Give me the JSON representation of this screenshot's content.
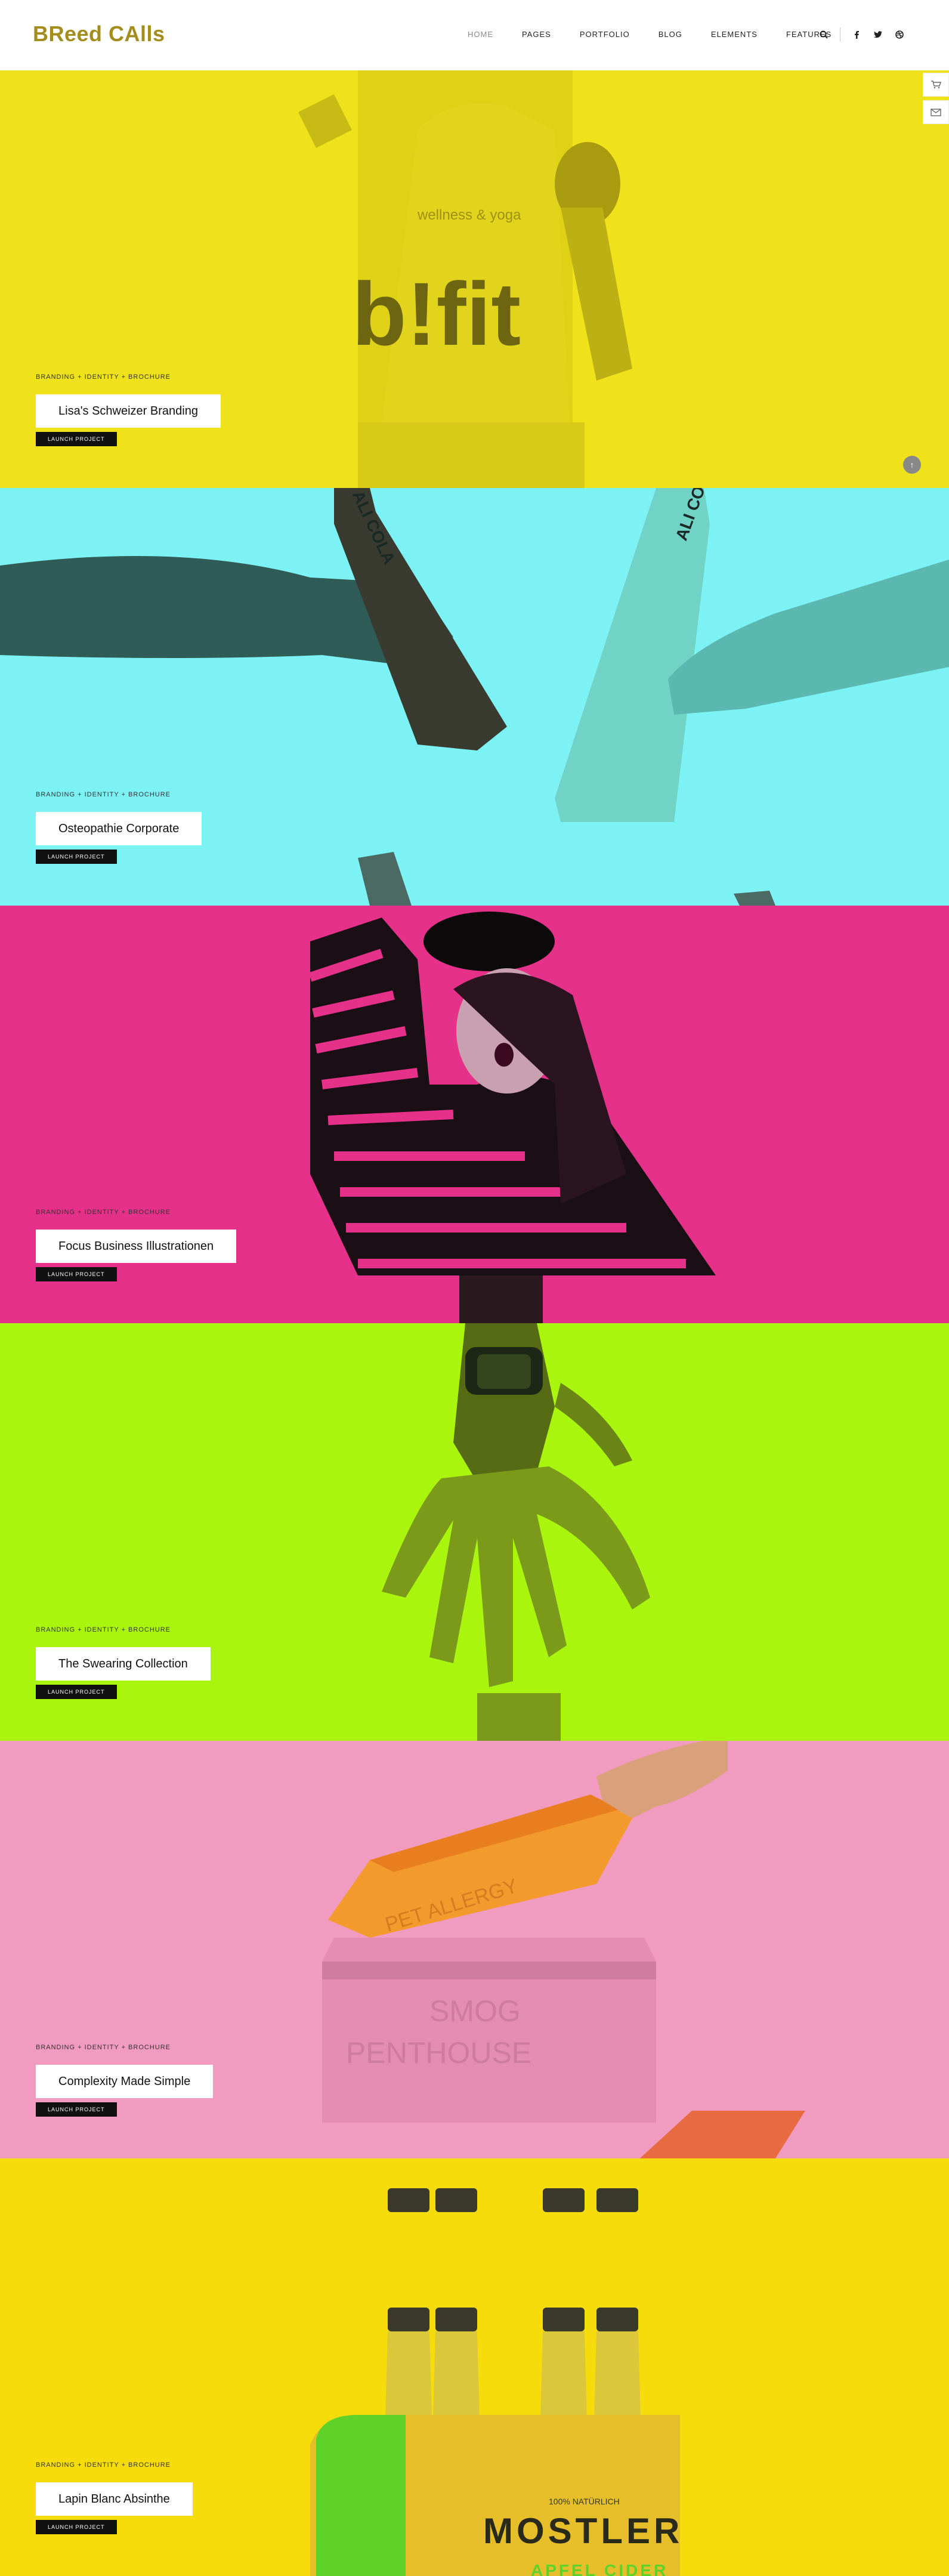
{
  "header": {
    "logo": "BReed CAlls",
    "nav": [
      "HOME",
      "PAGES",
      "PORTFOLIO",
      "BLOG",
      "ELEMENTS",
      "FEATURES"
    ]
  },
  "projects": [
    {
      "meta": "BRANDING + IDENTITY + BROCHURE",
      "title": "Lisa's Schweizer Branding",
      "cta": "LAUNCH PROJECT",
      "bg": "#efe21a"
    },
    {
      "meta": "BRANDING + IDENTITY + BROCHURE",
      "title": "Osteopathie Corporate",
      "cta": "LAUNCH PROJECT",
      "bg": "#7df2f5"
    },
    {
      "meta": "BRANDING + IDENTITY + BROCHURE",
      "title": "Focus Business Illustrationen",
      "cta": "LAUNCH PROJECT",
      "bg": "#e6318b"
    },
    {
      "meta": "BRANDING + IDENTITY + BROCHURE",
      "title": "The Swearing Collection",
      "cta": "LAUNCH PROJECT",
      "bg": "#aaf50e"
    },
    {
      "meta": "BRANDING + IDENTITY + BROCHURE",
      "title": "Complexity Made Simple",
      "cta": "LAUNCH PROJECT",
      "bg": "#f09bbf"
    },
    {
      "meta": "BRANDING + IDENTITY + BROCHURE",
      "title": "Lapin Blanc Absinthe",
      "cta": "LAUNCH PROJECT",
      "bg": "#f5dc0a"
    }
  ],
  "artwork": {
    "bag_line": "wellness & yoga",
    "bag_logo": "b!fit",
    "bottle_label": "ALI COLA",
    "box_top": "PET ALLERGY",
    "box_side1": "SMOG",
    "box_side2": "PENTHOUSE",
    "cider_small": "100% NATÜRLICH",
    "cider_brand": "MOSTLER",
    "cider_sub": "APFEL CIDER"
  },
  "icons": [
    "search-icon",
    "facebook-icon",
    "twitter-icon",
    "dribbble-icon",
    "cart-icon",
    "mail-icon",
    "arrow-up-icon"
  ]
}
